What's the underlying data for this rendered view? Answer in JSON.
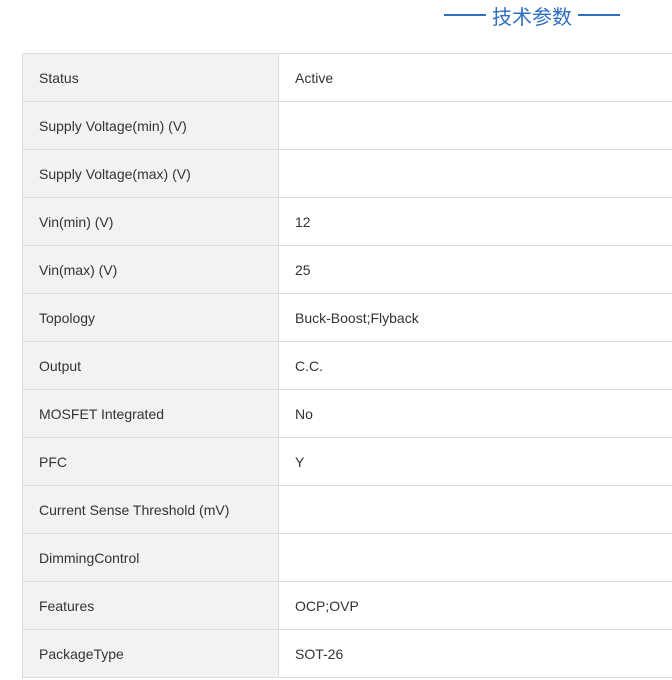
{
  "section": {
    "title": "技术参数"
  },
  "specs": [
    {
      "label": "Status",
      "value": "Active"
    },
    {
      "label": "Supply Voltage(min) (V)",
      "value": ""
    },
    {
      "label": "Supply Voltage(max) (V)",
      "value": ""
    },
    {
      "label": "Vin(min) (V)",
      "value": "12"
    },
    {
      "label": "Vin(max) (V)",
      "value": "25"
    },
    {
      "label": "Topology",
      "value": "Buck-Boost;Flyback"
    },
    {
      "label": "Output",
      "value": "C.C."
    },
    {
      "label": "MOSFET Integrated",
      "value": "No"
    },
    {
      "label": "PFC",
      "value": "Y"
    },
    {
      "label": "Current Sense Threshold (mV)",
      "value": ""
    },
    {
      "label": "DimmingControl",
      "value": ""
    },
    {
      "label": "Features",
      "value": "OCP;OVP"
    },
    {
      "label": "PackageType",
      "value": "SOT-26"
    }
  ],
  "colors": {
    "accent": "#2e6fc1",
    "label_bg": "#f2f2f2",
    "border": "#dcdcdc",
    "text": "#333333"
  }
}
